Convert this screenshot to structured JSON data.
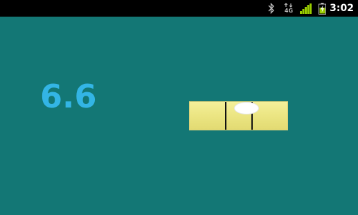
{
  "status_bar": {
    "time": "3:02",
    "network_label": "4G",
    "icons": [
      "bluetooth-icon",
      "network-4g-icon",
      "signal-icon",
      "battery-charging-icon"
    ]
  },
  "level": {
    "reading": "6.6",
    "bubble_position_fraction": 0.61
  },
  "colors": {
    "background": "#137775",
    "status_bar": "#000000",
    "reading_text": "#33b5e5",
    "tube": "#ece684",
    "bubble": "#ffffff"
  }
}
